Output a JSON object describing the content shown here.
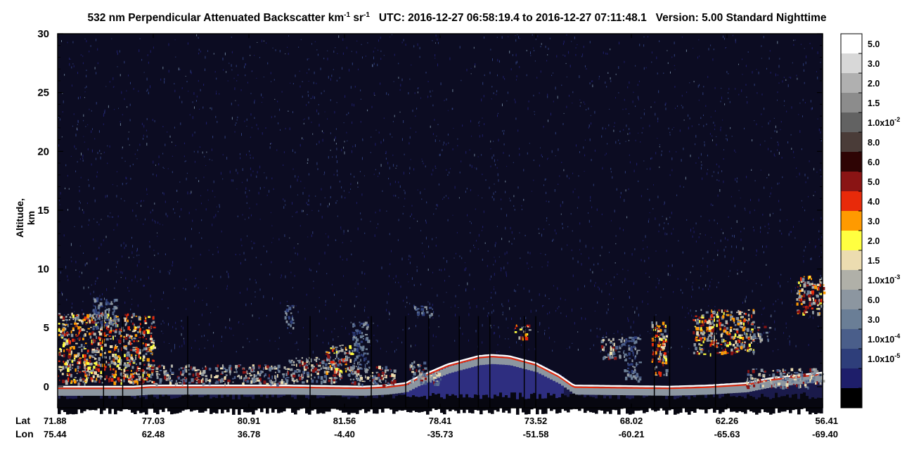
{
  "chart_data": {
    "type": "heatmap",
    "title_parts": {
      "prefix": "532 nm Perpendicular Attenuated Backscatter km",
      "sup1": "-1",
      "mid": " sr",
      "sup2": "-1",
      "utc": "UTC: 2016-12-27 06:58:19.4 to 2016-12-27 07:11:48.1",
      "version": "Version: 5.00 Standard Nighttime"
    },
    "ylabel": "Altitude, km",
    "ylim": [
      -1.8,
      30
    ],
    "yticks": [
      0,
      5,
      10,
      15,
      20,
      25,
      30
    ],
    "x_rows": {
      "lat_label": "Lat",
      "lon_label": "Lon",
      "lat": [
        "71.88",
        "77.03",
        "80.91",
        "81.56",
        "78.41",
        "73.52",
        "68.02",
        "62.26",
        "56.41"
      ],
      "lon": [
        "75.44",
        "62.48",
        "36.78",
        "-4.40",
        "-35.73",
        "-51.58",
        "-60.21",
        "-65.63",
        "-69.40"
      ]
    },
    "colorbar": {
      "colors": [
        "#ffffff",
        "#d8d8d8",
        "#b0b0b0",
        "#8c8c8c",
        "#626262",
        "#4a3c38",
        "#2e0404",
        "#8a1414",
        "#e82a0a",
        "#ff9a00",
        "#ffff40",
        "#ecdcb0",
        "#b0b0a8",
        "#8c96a0",
        "#6a7e96",
        "#4a5e8a",
        "#2e3e7a",
        "#1e1e6a",
        "#000000"
      ],
      "labels": [
        "5.0",
        "3.0",
        "2.0",
        "1.5",
        "1.0x10",
        "8.0",
        "6.0",
        "5.0",
        "4.0",
        "3.0",
        "2.0",
        "1.5",
        "1.0x10",
        "6.0",
        "3.0",
        "1.0x10",
        "1.0x10",
        ""
      ],
      "label_exps": [
        "",
        "",
        "",
        "",
        "-2",
        "",
        "",
        "",
        "",
        "",
        "",
        "",
        "-3",
        "",
        "",
        "-4",
        "-5",
        ""
      ]
    },
    "features": {
      "surface_profile": [
        [
          0,
          0.0
        ],
        [
          0.1,
          0.0
        ],
        [
          0.12,
          0.1
        ],
        [
          0.3,
          0.1
        ],
        [
          0.4,
          0.0
        ],
        [
          0.43,
          0.1
        ],
        [
          0.455,
          0.3
        ],
        [
          0.47,
          0.8
        ],
        [
          0.51,
          1.9
        ],
        [
          0.55,
          2.6
        ],
        [
          0.567,
          2.7
        ],
        [
          0.59,
          2.6
        ],
        [
          0.625,
          2.0
        ],
        [
          0.655,
          1.0
        ],
        [
          0.675,
          0.1
        ],
        [
          0.8,
          0.0
        ],
        [
          0.85,
          0.1
        ],
        [
          0.9,
          0.3
        ],
        [
          0.93,
          0.7
        ],
        [
          1.0,
          1.2
        ]
      ],
      "cloud_regions": [
        {
          "x0": 0.0,
          "x1": 0.125,
          "y0": 0.3,
          "y1": 6.3,
          "level": "high"
        },
        {
          "x0": 0.045,
          "x1": 0.075,
          "y0": 5.0,
          "y1": 7.6,
          "level": "low"
        },
        {
          "x0": 0.12,
          "x1": 0.3,
          "y0": 0.3,
          "y1": 1.9,
          "level": "mid"
        },
        {
          "x0": 0.3,
          "x1": 0.37,
          "y0": 0.4,
          "y1": 2.6,
          "level": "mid"
        },
        {
          "x0": 0.35,
          "x1": 0.385,
          "y0": 1.0,
          "y1": 3.6,
          "level": "high"
        },
        {
          "x0": 0.38,
          "x1": 0.44,
          "y0": 0.2,
          "y1": 1.8,
          "level": "mid"
        },
        {
          "x0": 0.385,
          "x1": 0.405,
          "y0": 1.5,
          "y1": 5.6,
          "level": "low"
        },
        {
          "x0": 0.296,
          "x1": 0.308,
          "y0": 5.0,
          "y1": 7.0,
          "level": "low"
        },
        {
          "x0": 0.46,
          "x1": 0.48,
          "y0": 0.5,
          "y1": 2.2,
          "level": "mid"
        },
        {
          "x0": 0.47,
          "x1": 0.5,
          "y0": 0.2,
          "y1": 1.5,
          "level": "mid"
        },
        {
          "x0": 0.465,
          "x1": 0.49,
          "y0": 6.0,
          "y1": 7.0,
          "level": "low"
        },
        {
          "x0": 0.596,
          "x1": 0.616,
          "y0": 4.2,
          "y1": 5.3,
          "level": "high"
        },
        {
          "x0": 0.71,
          "x1": 0.74,
          "y0": 2.5,
          "y1": 4.3,
          "level": "mid"
        },
        {
          "x0": 0.74,
          "x1": 0.76,
          "y0": 0.5,
          "y1": 4.3,
          "level": "low"
        },
        {
          "x0": 0.775,
          "x1": 0.795,
          "y0": 1.0,
          "y1": 5.6,
          "level": "high"
        },
        {
          "x0": 0.83,
          "x1": 0.91,
          "y0": 2.8,
          "y1": 6.6,
          "level": "high"
        },
        {
          "x0": 0.905,
          "x1": 0.93,
          "y0": 4.0,
          "y1": 5.2,
          "level": "mid"
        },
        {
          "x0": 0.965,
          "x1": 1.0,
          "y0": 6.3,
          "y1": 9.5,
          "level": "high"
        },
        {
          "x0": 0.9,
          "x1": 1.0,
          "y0": 0.0,
          "y1": 1.6,
          "level": "mid"
        }
      ]
    }
  }
}
